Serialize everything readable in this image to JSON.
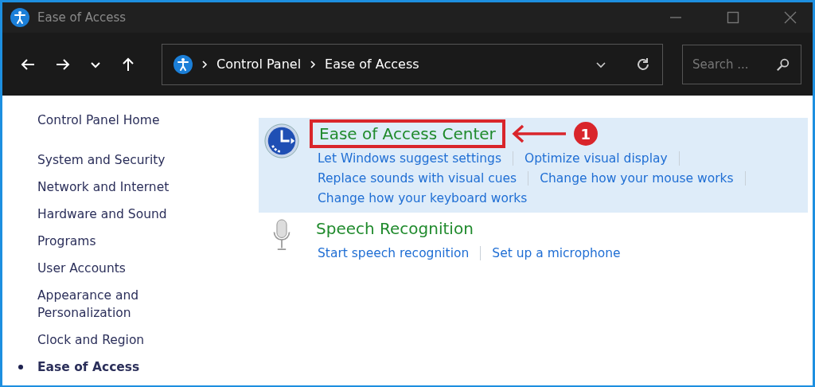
{
  "window": {
    "title": "Ease of Access"
  },
  "address_bar": {
    "breadcrumbs": [
      "Control Panel",
      "Ease of Access"
    ]
  },
  "search": {
    "placeholder": "Search ..."
  },
  "sidebar": {
    "items": [
      {
        "label": "Control Panel Home",
        "selected": false
      },
      {
        "label": "System and Security",
        "selected": false
      },
      {
        "label": "Network and Internet",
        "selected": false
      },
      {
        "label": "Hardware and Sound",
        "selected": false
      },
      {
        "label": "Programs",
        "selected": false
      },
      {
        "label": "User Accounts",
        "selected": false
      },
      {
        "label": "Appearance and Personalization",
        "selected": false
      },
      {
        "label": "Clock and Region",
        "selected": false
      },
      {
        "label": "Ease of Access",
        "selected": true
      }
    ]
  },
  "sections": [
    {
      "title": "Ease of Access Center",
      "kind": "ease-center",
      "highlighted": true,
      "callout": "1",
      "link_rows": [
        [
          "Let Windows suggest settings",
          "Optimize visual display"
        ],
        [
          "Replace sounds with visual cues",
          "Change how your mouse works"
        ],
        [
          "Change how your keyboard works"
        ]
      ]
    },
    {
      "title": "Speech Recognition",
      "kind": "speech",
      "highlighted": false,
      "link_rows": [
        [
          "Start speech recognition",
          "Set up a microphone"
        ]
      ]
    }
  ]
}
